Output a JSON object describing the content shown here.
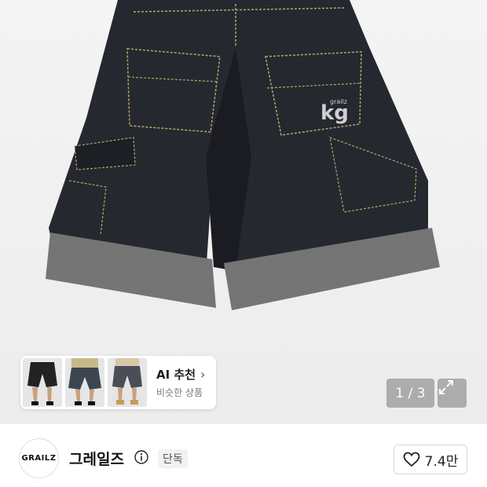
{
  "recommendation": {
    "title": "AI 추천",
    "subtitle": "비슷한 상품",
    "chevron_icon": "chevron-right-icon",
    "thumbnails": [
      "thumb-1",
      "thumb-2",
      "thumb-3"
    ]
  },
  "image_pager": {
    "text": "1 / 3",
    "expand_icon": "expand-icon"
  },
  "brand": {
    "logo_text": "GRAILZ",
    "name": "그레일즈",
    "info_icon": "info-icon",
    "badge": "단독"
  },
  "like": {
    "icon": "heart-icon",
    "count": "7.4만"
  },
  "colors": {
    "denim": "#1f2227",
    "stitch": "#b8a36a",
    "cuff": "#6b6b6b",
    "overlay": "#8c8c8c"
  }
}
